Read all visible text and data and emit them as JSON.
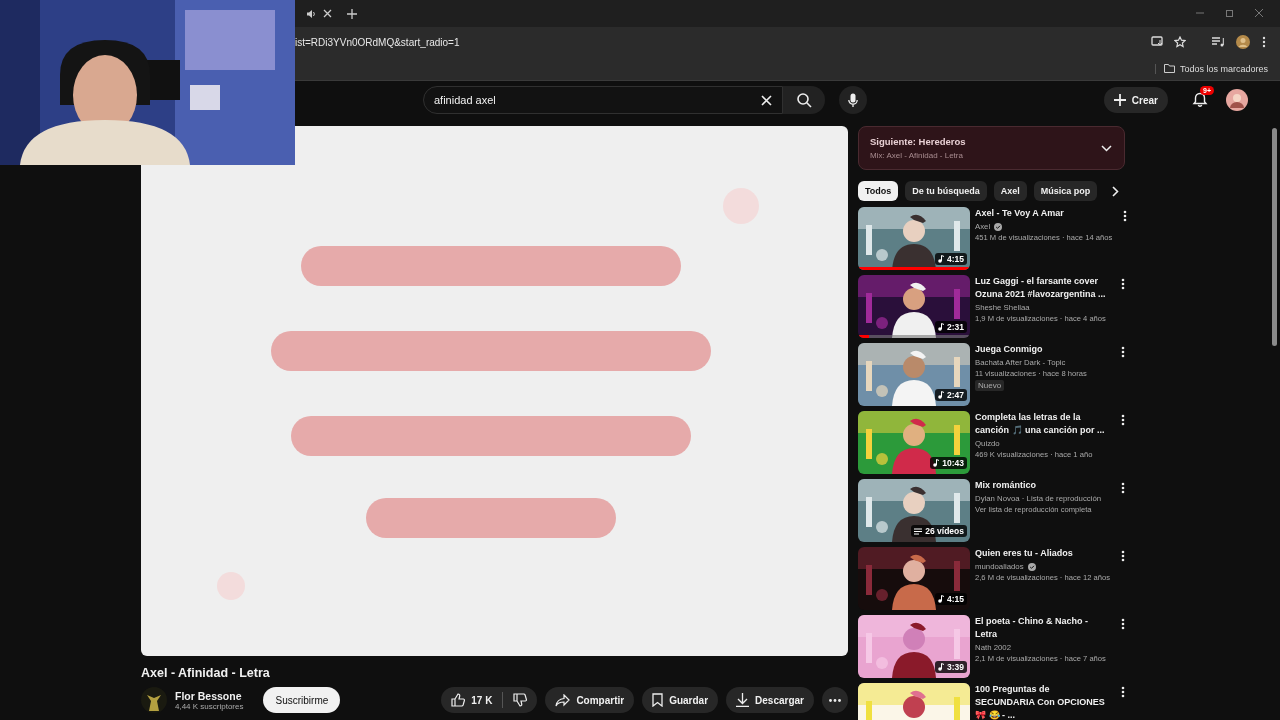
{
  "browser": {
    "address_bar": {
      "url": "ist=RDi3YVn0ORdMQ&start_radio=1"
    },
    "bookmarks_bar": {
      "folder": "Todos los marcadores"
    }
  },
  "header": {
    "search": {
      "value": "afinidad axel"
    },
    "create_button": "Crear",
    "notifications_badge": "9+"
  },
  "video": {
    "title": "Axel - Afinidad - Letra",
    "channel": {
      "name": "Flor Bessone",
      "subscribers": "4,44 K suscriptores"
    },
    "subscribe_button": "Suscribirme",
    "likes": "17 K",
    "actions": [
      {
        "kind": "share",
        "label": "Compartir"
      },
      {
        "kind": "save",
        "label": "Guardar"
      },
      {
        "kind": "download",
        "label": "Descargar"
      }
    ]
  },
  "up_next": {
    "title": "Siguiente: Herederos",
    "subtitle": "Mix: Axel - Afinidad - Letra",
    "expanded": false
  },
  "chips": [
    {
      "label": "Todos",
      "selected": true
    },
    {
      "label": "De tu búsqueda",
      "selected": false
    },
    {
      "label": "Axel",
      "selected": false
    },
    {
      "label": "Música pop",
      "selected": false
    }
  ],
  "recommendations": [
    {
      "kind": "video",
      "title": "Axel - Te Voy A Amar",
      "channel": "Axel",
      "verified": true,
      "meta": "451 M de visualizaciones · hace 14 años",
      "duration": "4:15",
      "level": 1
    },
    {
      "kind": "video",
      "title": "Luz Gaggi - el farsante cover Ozuna 2021 #lavozargentina ...",
      "channel": "Sheshe Shellaa",
      "verified": false,
      "meta": "1,9 M de visualizaciones · hace 4 años",
      "duration": "2:31",
      "level": 0.1
    },
    {
      "kind": "video",
      "title": "Juega Conmigo",
      "channel": "Bachata After Dark - Topic",
      "verified": false,
      "meta": "11 visualizaciones · hace 8 horas",
      "badge": "Nuevo",
      "duration": "2:47"
    },
    {
      "kind": "video",
      "title": "Completa las letras de la canción 🎵 una canción por ...",
      "channel": "Quizdo",
      "verified": false,
      "meta": "469 K visualizaciones · hace 1 año",
      "duration": "10:43"
    },
    {
      "kind": "playlist",
      "title": "Mix romántico",
      "channel": "Dylan Novoa · Lista de reproducción",
      "verified": false,
      "meta": "Ver lista de reproducción completa",
      "duration": "26 vídeos"
    },
    {
      "kind": "video",
      "title": "Quien eres tu - Aliados",
      "channel": "mundoaliados",
      "verified": true,
      "meta": "2,6 M de visualizaciones · hace 12 años",
      "duration": "4:15"
    },
    {
      "kind": "video",
      "title": "El poeta - Chino & Nacho - Letra",
      "channel": "Nath 2002",
      "verified": false,
      "meta": "2,1 M de visualizaciones · hace 7 años",
      "duration": "3:39"
    },
    {
      "title": "100 Preguntas de SECUNDARIA Con OPCIONES 🎀 😂 - ...",
      "verified": false
    }
  ]
}
